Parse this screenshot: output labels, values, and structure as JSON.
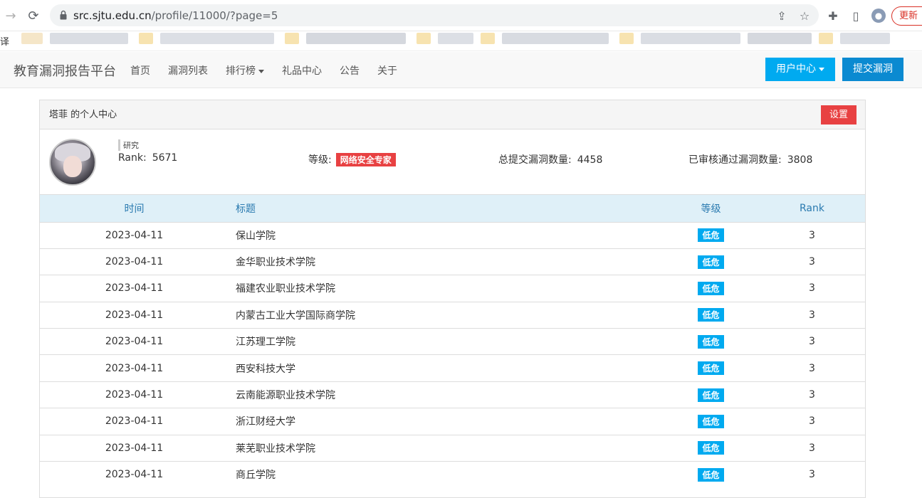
{
  "browser": {
    "url_host": "src.sjtu.edu.cn",
    "url_path": "/profile/11000/?page=5",
    "update_label": "更新",
    "bookmark_text": "译"
  },
  "site": {
    "brand": "教育漏洞报告平台",
    "nav": [
      "首页",
      "漏洞列表",
      "排行榜",
      "礼品中心",
      "公告",
      "关于"
    ],
    "user_center": "用户中心",
    "submit": "提交漏洞"
  },
  "panel": {
    "title": "塔菲 的个人中心",
    "settings": "设置",
    "handle": "研究",
    "rank_label": "Rank:",
    "rank_value": "5671",
    "level_label": "等级:",
    "level_value": "网络安全专家",
    "total_label": "总提交漏洞数量:",
    "total_value": "4458",
    "approved_label": "已审核通过漏洞数量:",
    "approved_value": "3808"
  },
  "table": {
    "headers": {
      "time": "时间",
      "title": "标题",
      "level": "等级",
      "rank": "Rank"
    },
    "rows": [
      {
        "time": "2023-04-11",
        "title": "保山学院",
        "level": "低危",
        "rank": "3"
      },
      {
        "time": "2023-04-11",
        "title": "金华职业技术学院",
        "level": "低危",
        "rank": "3"
      },
      {
        "time": "2023-04-11",
        "title": "福建农业职业技术学院",
        "level": "低危",
        "rank": "3"
      },
      {
        "time": "2023-04-11",
        "title": "内蒙古工业大学国际商学院",
        "level": "低危",
        "rank": "3"
      },
      {
        "time": "2023-04-11",
        "title": "江苏理工学院",
        "level": "低危",
        "rank": "3"
      },
      {
        "time": "2023-04-11",
        "title": "西安科技大学",
        "level": "低危",
        "rank": "3"
      },
      {
        "time": "2023-04-11",
        "title": "云南能源职业技术学院",
        "level": "低危",
        "rank": "3"
      },
      {
        "time": "2023-04-11",
        "title": "浙江财经大学",
        "level": "低危",
        "rank": "3"
      },
      {
        "time": "2023-04-11",
        "title": "莱芜职业技术学院",
        "level": "低危",
        "rank": "3"
      },
      {
        "time": "2023-04-11",
        "title": "商丘学院",
        "level": "低危",
        "rank": "3"
      }
    ]
  },
  "colors": {
    "primary": "#00aaf0",
    "submit": "#0b8ad1",
    "danger": "#e84142",
    "table_head": "#dff0f8"
  }
}
